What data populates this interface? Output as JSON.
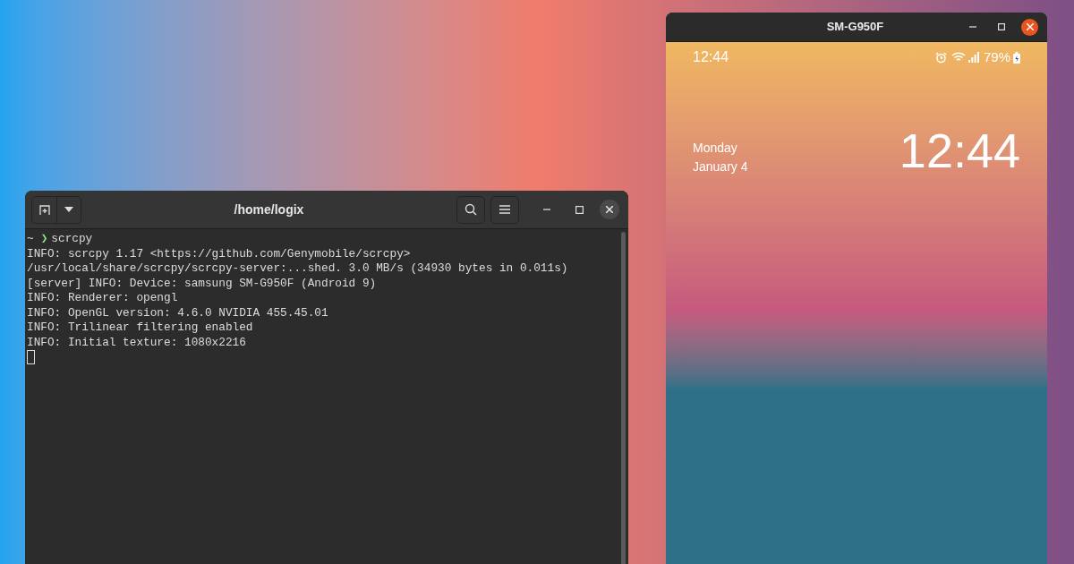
{
  "terminal": {
    "title": "/home/logix",
    "prompt": {
      "dir": "~",
      "arrow": "❯",
      "command": "scrcpy"
    },
    "lines": [
      "INFO: scrcpy 1.17 <https://github.com/Genymobile/scrcpy>",
      "/usr/local/share/scrcpy/scrcpy-server:...shed. 3.0 MB/s (34930 bytes in 0.011s)",
      "[server] INFO: Device: samsung SM-G950F (Android 9)",
      "INFO: Renderer: opengl",
      "INFO: OpenGL version: 4.6.0 NVIDIA 455.45.01",
      "INFO: Trilinear filtering enabled",
      "INFO: Initial texture: 1080x2216"
    ]
  },
  "phone_window": {
    "title": "SM-G950F",
    "status_bar": {
      "time": "12:44",
      "battery": "79%"
    },
    "lockscreen": {
      "day": "Monday",
      "date": "January 4",
      "clock": "12:44"
    }
  }
}
